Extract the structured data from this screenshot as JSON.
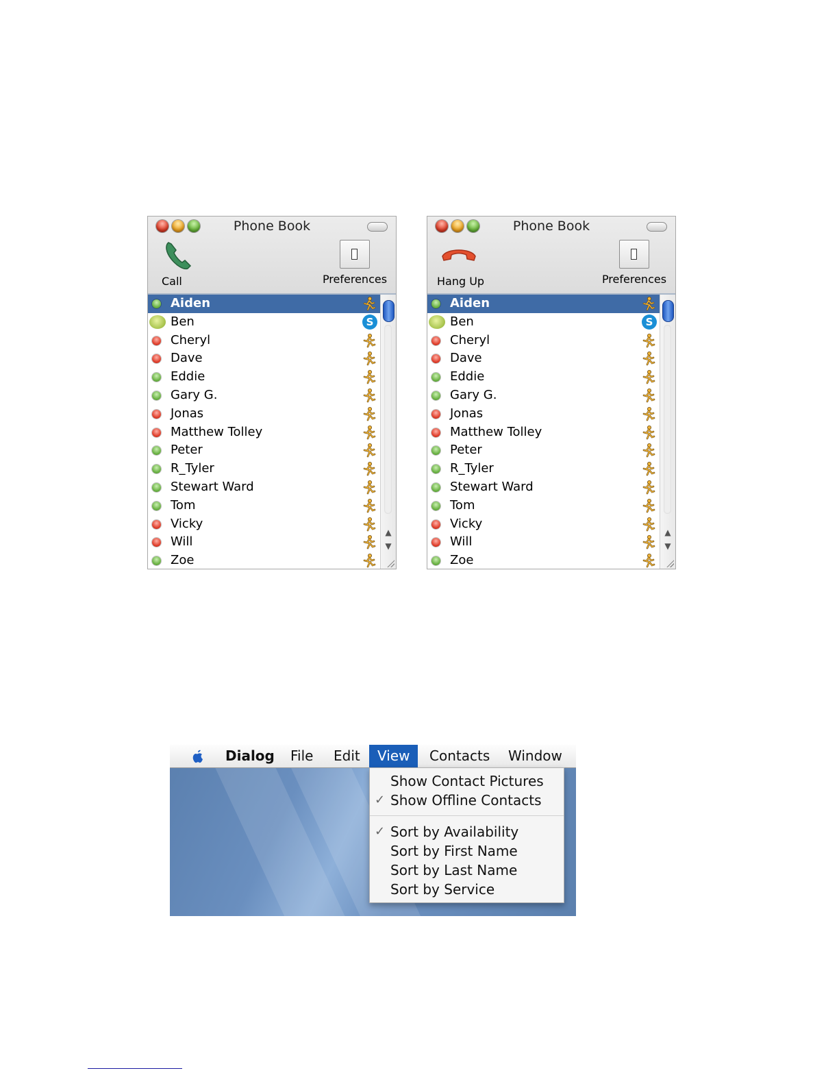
{
  "windows": [
    {
      "title": "Phone Book",
      "action_label": "Call",
      "action_icon": "phone-icon",
      "pref_label": "Preferences",
      "contacts": [
        {
          "name": "Aiden",
          "status": "green",
          "service": "aim",
          "selected": true
        },
        {
          "name": "Ben",
          "status": "phone",
          "service": "skype"
        },
        {
          "name": "Cheryl",
          "status": "red",
          "service": "aim"
        },
        {
          "name": "Dave",
          "status": "red",
          "service": "aim"
        },
        {
          "name": "Eddie",
          "status": "green",
          "service": "aim"
        },
        {
          "name": "Gary G.",
          "status": "green",
          "service": "aim"
        },
        {
          "name": "Jonas",
          "status": "red",
          "service": "aim"
        },
        {
          "name": "Matthew Tolley",
          "status": "red",
          "service": "aim"
        },
        {
          "name": "Peter",
          "status": "green",
          "service": "aim"
        },
        {
          "name": "R_Tyler",
          "status": "green",
          "service": "aim"
        },
        {
          "name": "Stewart Ward",
          "status": "green",
          "service": "aim"
        },
        {
          "name": "Tom",
          "status": "green",
          "service": "aim"
        },
        {
          "name": "Vicky",
          "status": "red",
          "service": "aim"
        },
        {
          "name": "Will",
          "status": "red",
          "service": "aim"
        },
        {
          "name": "Zoe",
          "status": "green",
          "service": "aim"
        }
      ]
    },
    {
      "title": "Phone Book",
      "action_label": "Hang Up",
      "action_icon": "hang-up-icon",
      "pref_label": "Preferences",
      "contacts": [
        {
          "name": "Aiden",
          "status": "green",
          "service": "aim",
          "selected": true
        },
        {
          "name": "Ben",
          "status": "phone",
          "service": "skype"
        },
        {
          "name": "Cheryl",
          "status": "red",
          "service": "aim"
        },
        {
          "name": "Dave",
          "status": "red",
          "service": "aim"
        },
        {
          "name": "Eddie",
          "status": "green",
          "service": "aim"
        },
        {
          "name": "Gary G.",
          "status": "green",
          "service": "aim"
        },
        {
          "name": "Jonas",
          "status": "red",
          "service": "aim"
        },
        {
          "name": "Matthew Tolley",
          "status": "red",
          "service": "aim"
        },
        {
          "name": "Peter",
          "status": "green",
          "service": "aim"
        },
        {
          "name": "R_Tyler",
          "status": "green",
          "service": "aim"
        },
        {
          "name": "Stewart Ward",
          "status": "green",
          "service": "aim"
        },
        {
          "name": "Tom",
          "status": "green",
          "service": "aim"
        },
        {
          "name": "Vicky",
          "status": "red",
          "service": "aim"
        },
        {
          "name": "Will",
          "status": "red",
          "service": "aim"
        },
        {
          "name": "Zoe",
          "status": "green",
          "service": "aim"
        }
      ]
    }
  ],
  "menubar": {
    "app": "Dialog",
    "items": [
      "File",
      "Edit",
      "View",
      "Contacts",
      "Window"
    ],
    "open_item": "View"
  },
  "view_menu": {
    "group1": [
      {
        "label": "Show Contact Pictures",
        "checked": false
      },
      {
        "label": "Show Offline Contacts",
        "checked": true
      }
    ],
    "group2": [
      {
        "label": "Sort by Availability",
        "checked": true
      },
      {
        "label": "Sort by First Name",
        "checked": false
      },
      {
        "label": "Sort by Last Name",
        "checked": false
      },
      {
        "label": "Sort by Service",
        "checked": false
      }
    ],
    "check_glyph": "✓"
  },
  "colors": {
    "selection": "#3f6ba6",
    "menu_highlight": "#1a5eb8",
    "online": "#69b142",
    "offline": "#df3d2a"
  }
}
